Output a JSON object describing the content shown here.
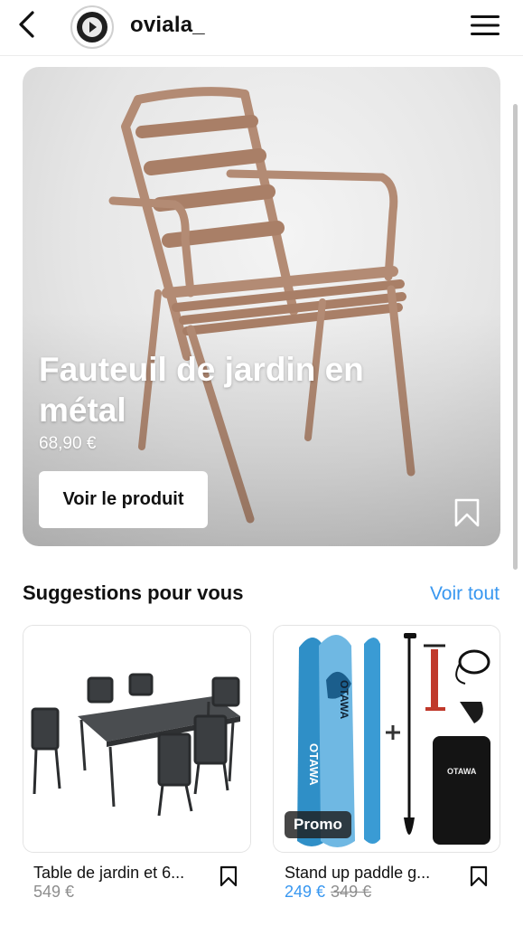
{
  "header": {
    "username": "oviala_",
    "back_icon": "chevron-left-icon",
    "menu_icon": "hamburger-menu-icon"
  },
  "hero": {
    "title": "Fauteuil de jardin en métal",
    "price": "68,90 €",
    "cta_label": "Voir le produit",
    "save_icon": "bookmark-icon"
  },
  "suggestions": {
    "title": "Suggestions pour vous",
    "see_all": "Voir tout",
    "products": [
      {
        "name": "Table de jardin et 6...",
        "price": "549 €"
      },
      {
        "name": "Stand up paddle g...",
        "badge": "Promo",
        "sale_price": "249 €",
        "old_price": "349 €"
      }
    ]
  },
  "colors": {
    "link": "#3897f0",
    "muted": "#8e8e8e",
    "chair": "#b8917a"
  }
}
